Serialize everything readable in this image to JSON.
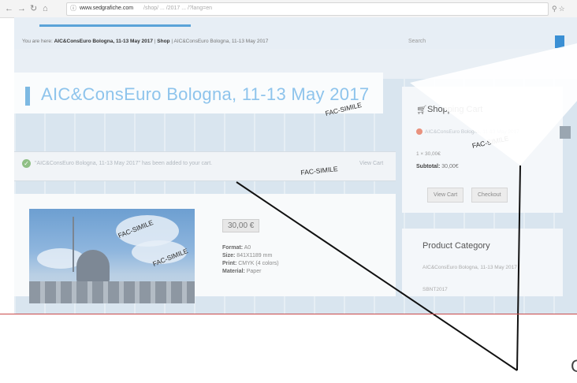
{
  "browser": {
    "url_host": "www.sedgrafiche.com",
    "url_path": "/shop/ ... /2017 ... /?lang=en",
    "nav_icons": [
      "←",
      "→",
      "↻",
      "⌂"
    ]
  },
  "breadcrumb": {
    "prefix": "You are here:",
    "event": "AIC&ConsEuro Bologna, 11-13 May 2017",
    "sep": "|",
    "shop": "Shop",
    "trail": "| AIC&ConsEuro Bologna, 11-13 May 2017"
  },
  "search": {
    "label": "Search"
  },
  "page": {
    "title": "AIC&ConsEuro Bologna, 11-13 May 2017"
  },
  "notice": {
    "text": "\"AIC&ConsEuro Bologna, 11-13 May 2017\" has been added to your cart.",
    "link": "View Cart"
  },
  "product": {
    "price": "30,00 €",
    "specs": [
      {
        "label": "Format:",
        "value": "A0"
      },
      {
        "label": "Size:",
        "value": "841X1189 mm"
      },
      {
        "label": "Print:",
        "value": "CMYK (4 colors)"
      },
      {
        "label": "Material:",
        "value": "Paper"
      }
    ]
  },
  "cart": {
    "title": "Shopping Cart",
    "item": "AIC&ConsEuro Bologna, 11-13 May 2017",
    "qty": "1 × 30,00€",
    "subtotal_label": "Subtotal:",
    "subtotal_value": "30,00€",
    "view_button": "View Cart",
    "checkout_button": "Checkout"
  },
  "categories": {
    "title": "Product Category",
    "items": [
      "AIC&ConsEuro Bologna, 11-13 May 2017",
      "SBNT2017"
    ]
  },
  "watermark": "FAC-SIMILE",
  "corner_letter": "C",
  "colors": {
    "accent": "#5aa3d8",
    "title": "#8ec4ec",
    "search_btn": "#3a8fd4"
  }
}
